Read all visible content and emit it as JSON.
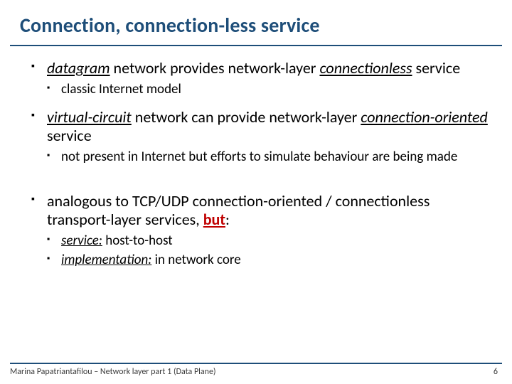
{
  "title": "Connection, connection-less service",
  "bullets": {
    "b1": {
      "seg1": "datagram",
      "seg2": " network provides network-layer ",
      "seg3": "connectionless",
      "seg4": " service",
      "sub1": "classic Internet model"
    },
    "b2": {
      "seg1": "virtual-circuit",
      "seg2": " network can provide network-layer ",
      "seg3": "connection-oriented",
      "seg4": " service",
      "sub1": "not present in Internet but efforts to simulate behaviour are being made"
    },
    "b3": {
      "line1a": "analogous to TCP/UDP connection-oriented / connectionless transport-layer services, ",
      "line1b": "but",
      "line1c": ":",
      "sub1a": "service:",
      "sub1b": " host-to-host",
      "sub2a": "implementation:",
      "sub2b": " in network core"
    }
  },
  "footer": {
    "text": "Marina Papatriantafilou –  Network layer part 1 (Data Plane)",
    "page": "6"
  }
}
